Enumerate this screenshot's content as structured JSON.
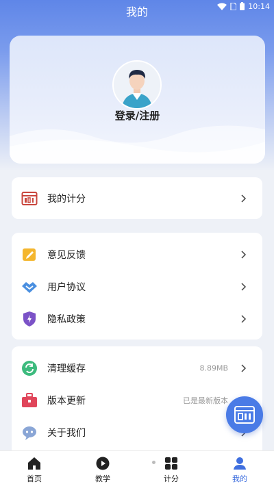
{
  "status_bar": {
    "time": "10:14"
  },
  "header": {
    "title": "我的"
  },
  "profile": {
    "login_label": "登录/注册"
  },
  "menu_score": {
    "label": "我的计分"
  },
  "menu_group_1": [
    {
      "label": "意见反馈",
      "icon": "feedback-icon"
    },
    {
      "label": "用户协议",
      "icon": "handshake-icon"
    },
    {
      "label": "隐私政策",
      "icon": "shield-icon"
    }
  ],
  "menu_group_2": [
    {
      "label": "清理缓存",
      "icon": "refresh-icon",
      "value": "8.89MB"
    },
    {
      "label": "版本更新",
      "icon": "briefcase-icon",
      "value": "已是最新版本"
    },
    {
      "label": "关于我们",
      "icon": "chat-icon"
    }
  ],
  "tabs": [
    {
      "label": "首页",
      "icon": "home-icon"
    },
    {
      "label": "教学",
      "icon": "play-icon"
    },
    {
      "label": "计分",
      "icon": "grid-icon"
    },
    {
      "label": "我的",
      "icon": "user-icon",
      "active": true
    }
  ],
  "colors": {
    "accent": "#3f6fdf",
    "header_gradient_top": "#5f86e8",
    "background": "#eef1f7",
    "fab": "#4a7be6"
  }
}
